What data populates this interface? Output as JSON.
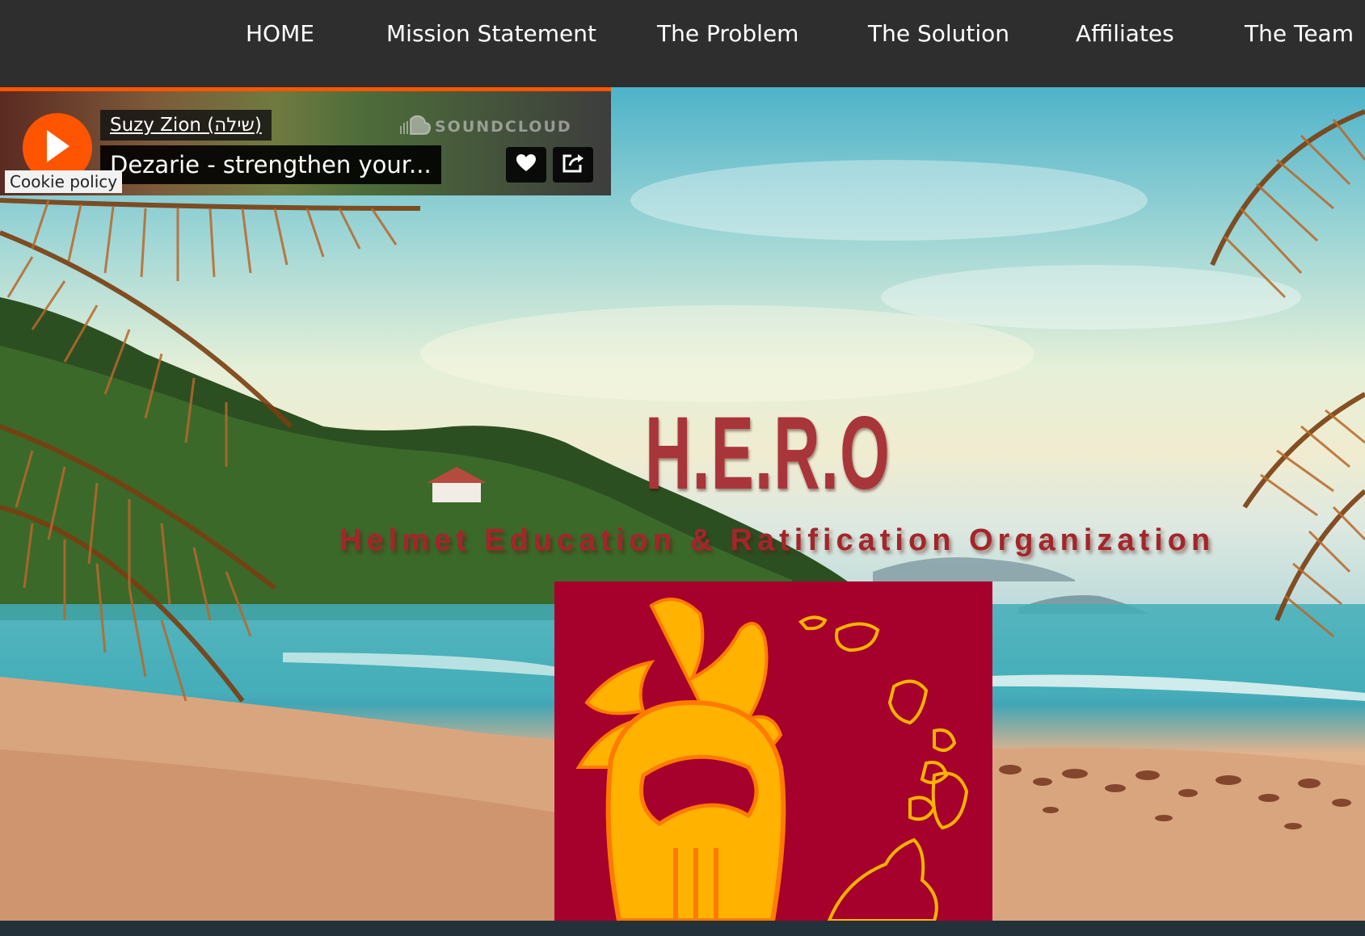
{
  "nav": {
    "items": [
      "HOME",
      "Mission Statement",
      "The Problem",
      "The Solution",
      "Affiliates",
      "The Team"
    ]
  },
  "soundcloud": {
    "artist": "Suzy Zion (שילה)",
    "track_title": "Dezarie - strengthen your...",
    "brand": "SOUNDCLOUD",
    "accent_color": "#ff5500",
    "icons": [
      "play-icon",
      "heart-icon",
      "share-icon",
      "soundcloud-cloud-icon"
    ]
  },
  "cookie": {
    "label": "Cookie policy"
  },
  "hero": {
    "title": "H.E.R.O",
    "subtitle": "Helmet Education & Ratification Organization",
    "title_color": "#a8353a",
    "logo_background": "#a6002c",
    "logo_foreground": "#ffb300"
  },
  "colors": {
    "nav_background": "#2e2e2e",
    "footer_strip": "#23313b"
  }
}
